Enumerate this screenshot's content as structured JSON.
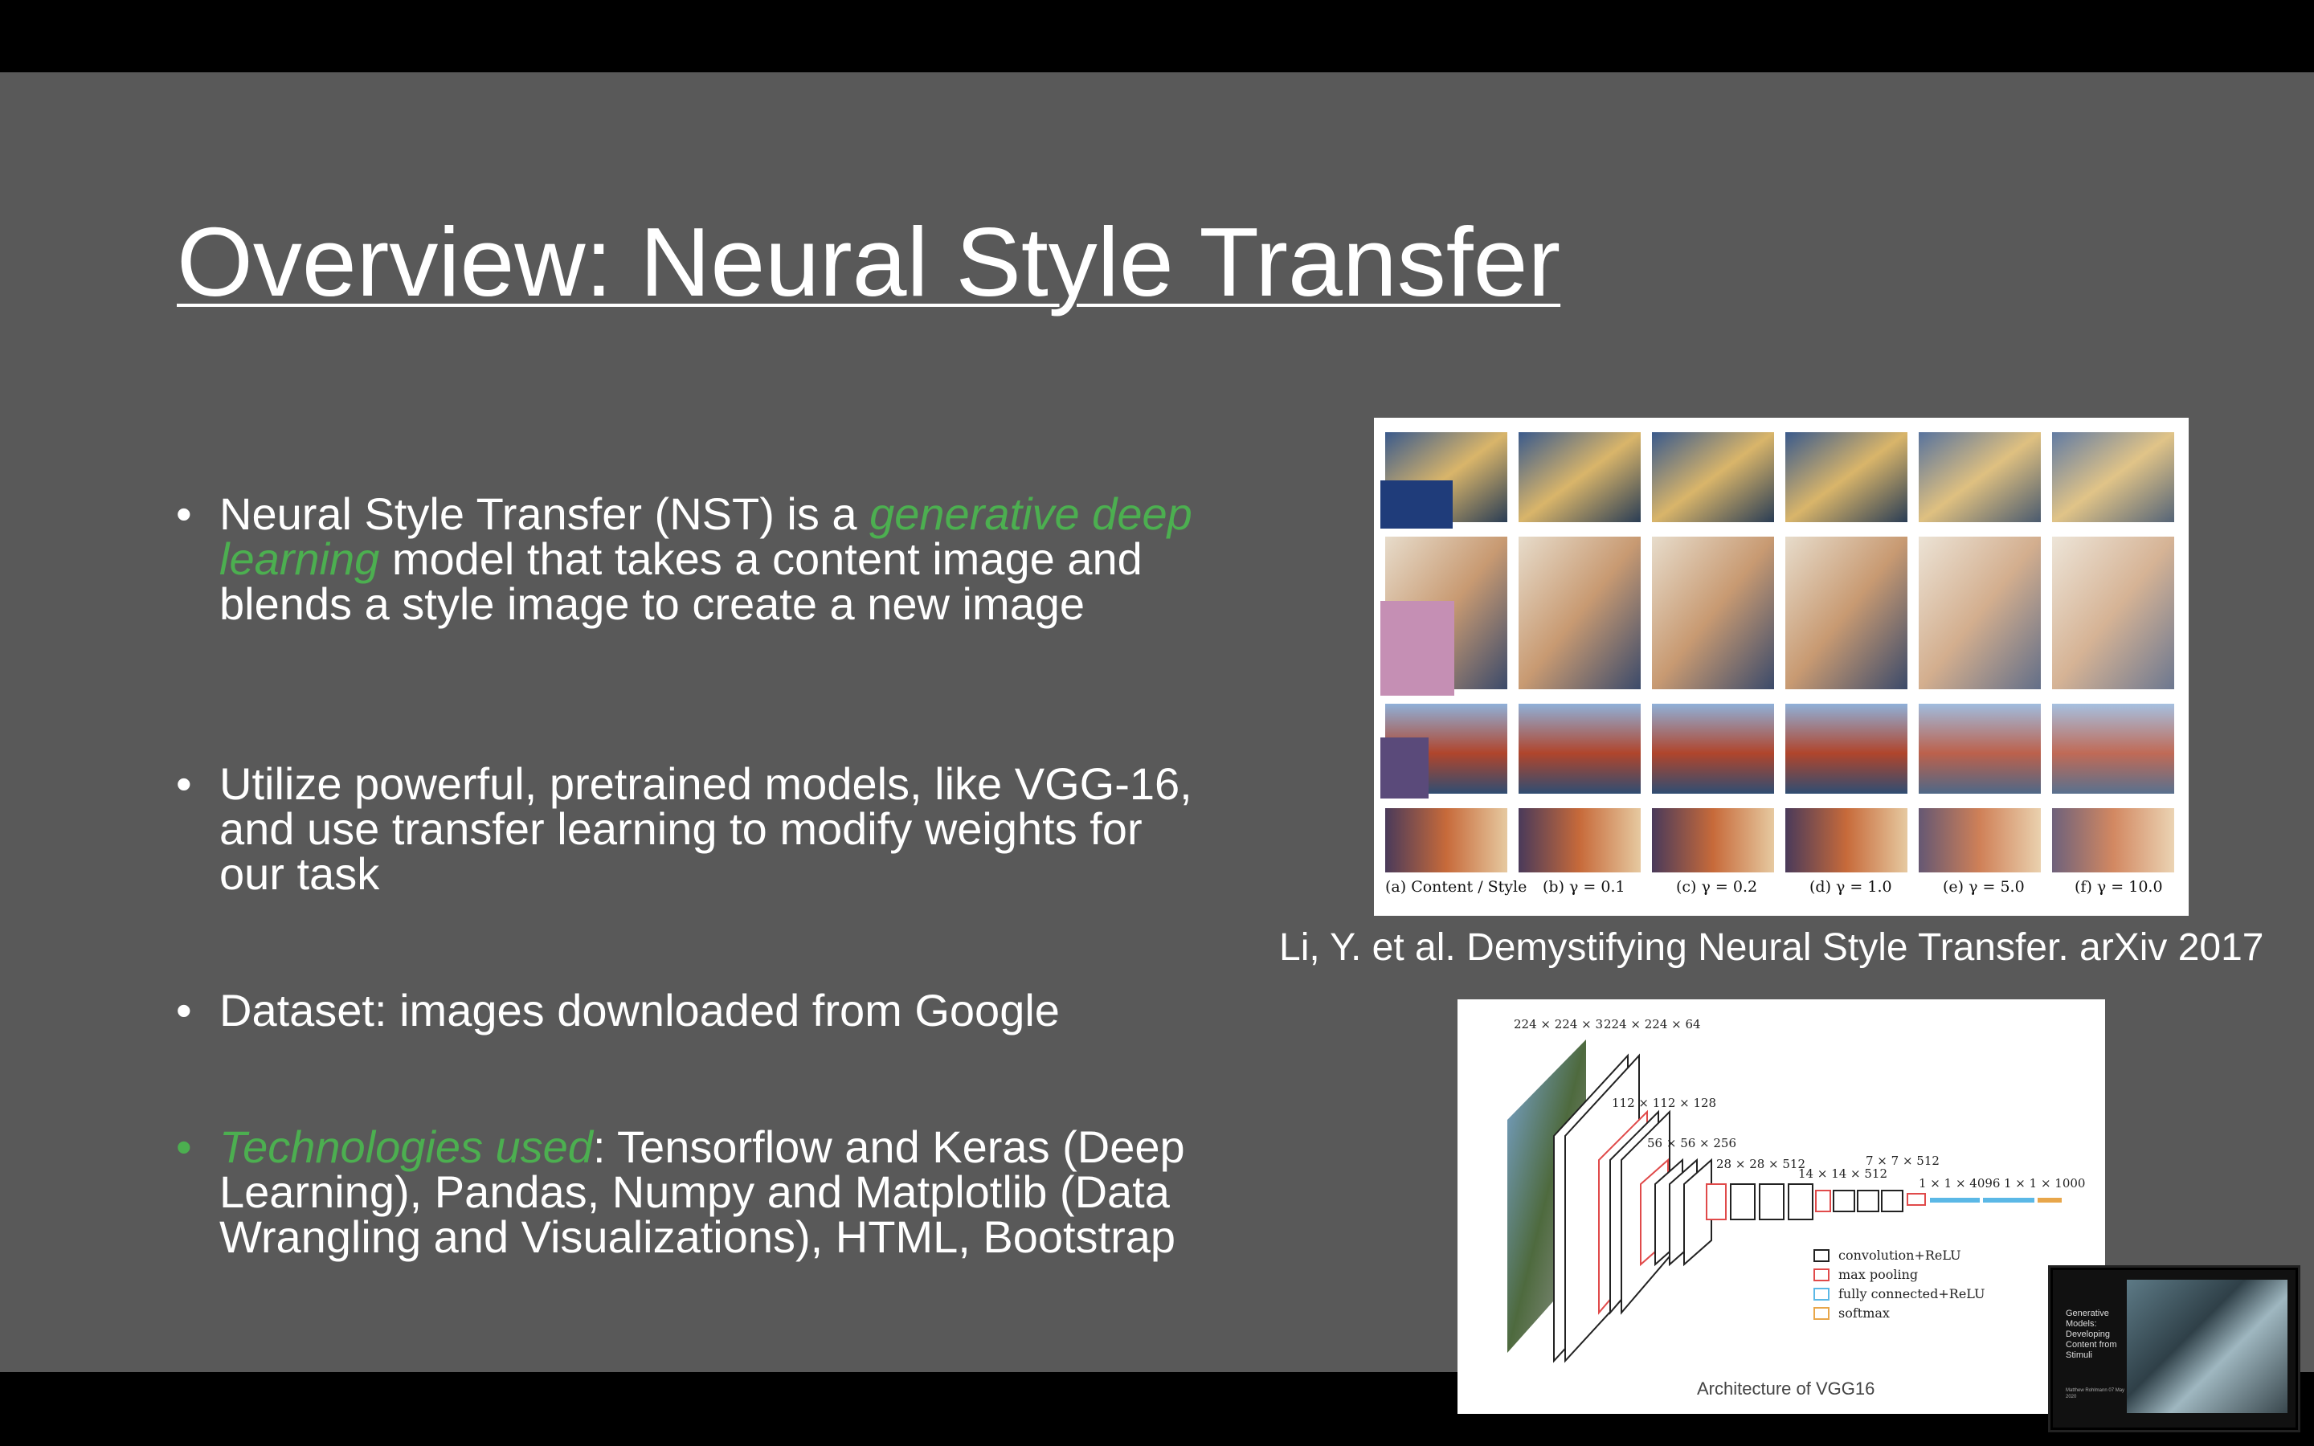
{
  "slide": {
    "title": "Overview: Neural Style Transfer",
    "bullets": [
      {
        "prefix": "Neural Style Transfer (NST) is a ",
        "highlight": "generative deep learning",
        "suffix": " model that takes a content image and blends a style image to create a new image"
      },
      {
        "text": "Utilize powerful, pretrained models, like VGG-16, and use transfer learning to modify weights for our task"
      },
      {
        "text": "Dataset: images downloaded from Google"
      },
      {
        "highlight": "Technologies used",
        "suffix": ": Tensorflow and Keras (Deep Learning), Pandas, Numpy and Matplotlib (Data Wrangling and Visualizations), HTML, Bootstrap"
      }
    ],
    "highlight_color": "#4caf50",
    "figure1": {
      "caption": "Li, Y. et al. Demystifying Neural Style Transfer. arXiv 2017",
      "column_labels": [
        "(a) Content / Style",
        "(b) γ = 0.1",
        "(c) γ = 0.2",
        "(d) γ = 1.0",
        "(e) γ = 5.0",
        "(f) γ = 10.0"
      ]
    },
    "figure2": {
      "caption": "Architecture of VGG16",
      "dims": [
        "224 × 224 × 3",
        "224 × 224 × 64",
        "112 × 112 × 128",
        "56 × 56 × 256",
        "28 × 28 × 512",
        "14 × 14 × 512",
        "7 × 7 × 512",
        "1 × 1 × 4096",
        "1 × 1 × 1000"
      ],
      "legend": [
        "convolution+ReLU",
        "max pooling",
        "fully connected+ReLU",
        "softmax"
      ]
    },
    "thumbnail": {
      "title": "Generative Models: Developing Content from Stimuli",
      "subtitle": "Matthew Rohlmann 07 May 2020"
    }
  }
}
